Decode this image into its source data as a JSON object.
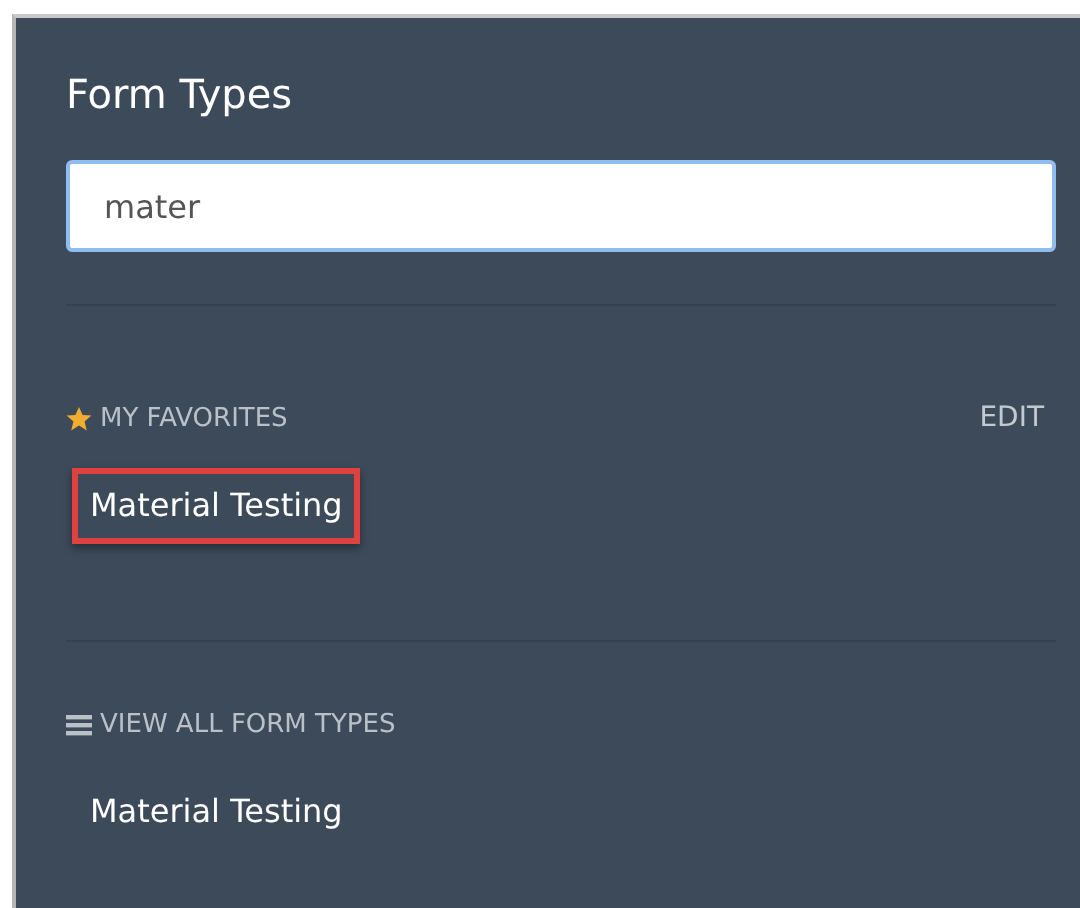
{
  "panel": {
    "title": "Form Types"
  },
  "search": {
    "value": "mater"
  },
  "favorites": {
    "heading": "MY FAVORITES",
    "action": "EDIT",
    "items": [
      {
        "label": "Material Testing",
        "highlighted": true
      }
    ]
  },
  "all_types": {
    "heading": "VIEW ALL FORM TYPES",
    "items": [
      {
        "label": "Material Testing",
        "highlighted": false
      }
    ]
  }
}
